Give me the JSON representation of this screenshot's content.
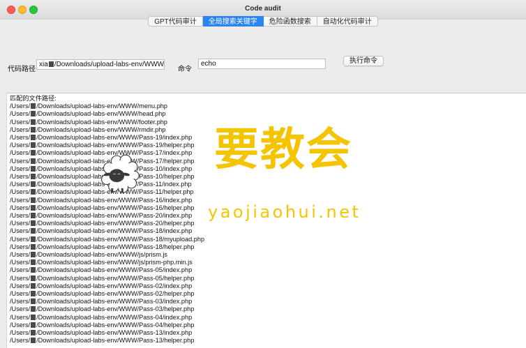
{
  "window": {
    "title": "Code audit"
  },
  "tabs": [
    {
      "label": "GPT代码审计"
    },
    {
      "label": "全局搜索关键字",
      "active": true
    },
    {
      "label": "危险函数搜索"
    },
    {
      "label": "自动化代码审计"
    }
  ],
  "form": {
    "path_label": "代码路径",
    "path_value": "/Downloads/upload-labs-env/WWW",
    "path_prefix": "xia",
    "cmd_label": "命令",
    "cmd_value": "echo",
    "run_button": "执行命令"
  },
  "results": {
    "header": "匹配的文件路径:",
    "prefix": "/Users/",
    "lines": [
      "/Downloads/upload-labs-env/WWW/menu.php",
      "/Downloads/upload-labs-env/WWW/head.php",
      "/Downloads/upload-labs-env/WWW/footer.php",
      "/Downloads/upload-labs-env/WWW/rmdir.php",
      "/Downloads/upload-labs-env/WWW/Pass-19/index.php",
      "/Downloads/upload-labs-env/WWW/Pass-19/helper.php",
      "/Downloads/upload-labs-env/WWW/Pass-17/index.php",
      "/Downloads/upload-labs-env/WWW/Pass-17/helper.php",
      "/Downloads/upload-labs-env/WWW/Pass-10/index.php",
      "/Downloads/upload-labs-env/WWW/Pass-10/helper.php",
      "/Downloads/upload-labs-env/WWW/Pass-11/index.php",
      "/Downloads/upload-labs-env/WWW/Pass-11/helper.php",
      "/Downloads/upload-labs-env/WWW/Pass-16/index.php",
      "/Downloads/upload-labs-env/WWW/Pass-16/helper.php",
      "/Downloads/upload-labs-env/WWW/Pass-20/index.php",
      "/Downloads/upload-labs-env/WWW/Pass-20/helper.php",
      "/Downloads/upload-labs-env/WWW/Pass-18/index.php",
      "/Downloads/upload-labs-env/WWW/Pass-18/myupload.php",
      "/Downloads/upload-labs-env/WWW/Pass-18/helper.php",
      "/Downloads/upload-labs-env/WWW/js/prism.js",
      "/Downloads/upload-labs-env/WWW/js/prism-php.min.js",
      "/Downloads/upload-labs-env/WWW/Pass-05/index.php",
      "/Downloads/upload-labs-env/WWW/Pass-05/helper.php",
      "/Downloads/upload-labs-env/WWW/Pass-02/index.php",
      "/Downloads/upload-labs-env/WWW/Pass-02/helper.php",
      "/Downloads/upload-labs-env/WWW/Pass-03/index.php",
      "/Downloads/upload-labs-env/WWW/Pass-03/helper.php",
      "/Downloads/upload-labs-env/WWW/Pass-04/index.php",
      "/Downloads/upload-labs-env/WWW/Pass-04/helper.php",
      "/Downloads/upload-labs-env/WWW/Pass-13/index.php",
      "/Downloads/upload-labs-env/WWW/Pass-13/helper.php"
    ]
  },
  "watermark": {
    "text": "要教会",
    "url": "yaojiaohui.net"
  },
  "colors": {
    "accent": "#2a84f4",
    "watermark": "#f5c400"
  },
  "icons": [
    "close-icon",
    "minimize-icon",
    "zoom-icon",
    "sheep-logo-icon"
  ]
}
